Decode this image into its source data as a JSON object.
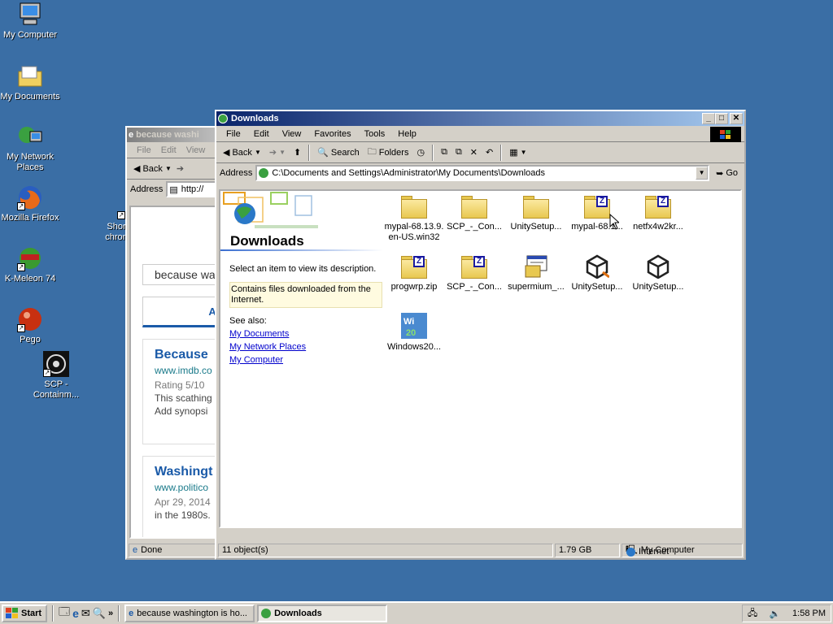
{
  "desktop": {
    "icons": [
      {
        "label": "My Computer"
      },
      {
        "label": "My Documents"
      },
      {
        "label": "My Network Places"
      },
      {
        "label": "Mozilla Firefox"
      },
      {
        "label": "K-Meleon 74"
      },
      {
        "label": "Pego"
      },
      {
        "label": "SCP - Containm..."
      },
      {
        "label": "Shor chron"
      }
    ]
  },
  "browser": {
    "title": "because washi",
    "menu": [
      "File",
      "Edit",
      "View"
    ],
    "back_label": "Back",
    "address_label": "Address",
    "address_value": "http://",
    "search_text": "because wa",
    "tab_label": "AL",
    "results": [
      {
        "title": "Because",
        "url": "www.imdb.co",
        "line1": "Rating 5/10",
        "line2": "This scathing",
        "line3": "Add synopsi"
      },
      {
        "title": "Washingt",
        "url": "www.politico",
        "line1": "Apr 29, 2014",
        "line2": "in the 1980s."
      }
    ],
    "status": "Done",
    "zone": "Internet"
  },
  "explorer": {
    "title": "Downloads",
    "menu": [
      "File",
      "Edit",
      "View",
      "Favorites",
      "Tools",
      "Help"
    ],
    "toolbar": {
      "back": "Back",
      "search": "Search",
      "folders": "Folders"
    },
    "address_label": "Address",
    "address_value": "C:\\Documents and Settings\\Administrator\\My Documents\\Downloads",
    "go_label": "Go",
    "pane": {
      "heading": "Downloads",
      "hint": "Select an item to view its description.",
      "description": "Contains files downloaded from the Internet.",
      "see_also": "See also:",
      "links": [
        "My Documents",
        "My Network Places",
        "My Computer"
      ]
    },
    "files": [
      {
        "name": "mypal-68.13.9.en-US.win32",
        "icon": "folder-icon"
      },
      {
        "name": "SCP_-_Con...",
        "icon": "folder-icon"
      },
      {
        "name": "UnitySetup...",
        "icon": "folder-icon"
      },
      {
        "name": "mypal-68.1...",
        "icon": "zip-folder-icon"
      },
      {
        "name": "netfx4w2kr...",
        "icon": "zip-folder-icon"
      },
      {
        "name": "progwrp.zip",
        "icon": "zip-folder-icon"
      },
      {
        "name": "SCP_-_Con...",
        "icon": "zip-folder-icon"
      },
      {
        "name": "supermium_...",
        "icon": "installer-icon"
      },
      {
        "name": "UnitySetup...",
        "icon": "unity-icon"
      },
      {
        "name": "UnitySetup...",
        "icon": "unity-icon"
      },
      {
        "name": "Windows20...",
        "icon": "windows-icon"
      }
    ],
    "status": {
      "count": "11 object(s)",
      "size": "1.79 GB",
      "location": "My Computer"
    }
  },
  "taskbar": {
    "start": "Start",
    "tasks": [
      "because washington is ho...",
      "Downloads"
    ],
    "clock": "1:58 PM"
  }
}
